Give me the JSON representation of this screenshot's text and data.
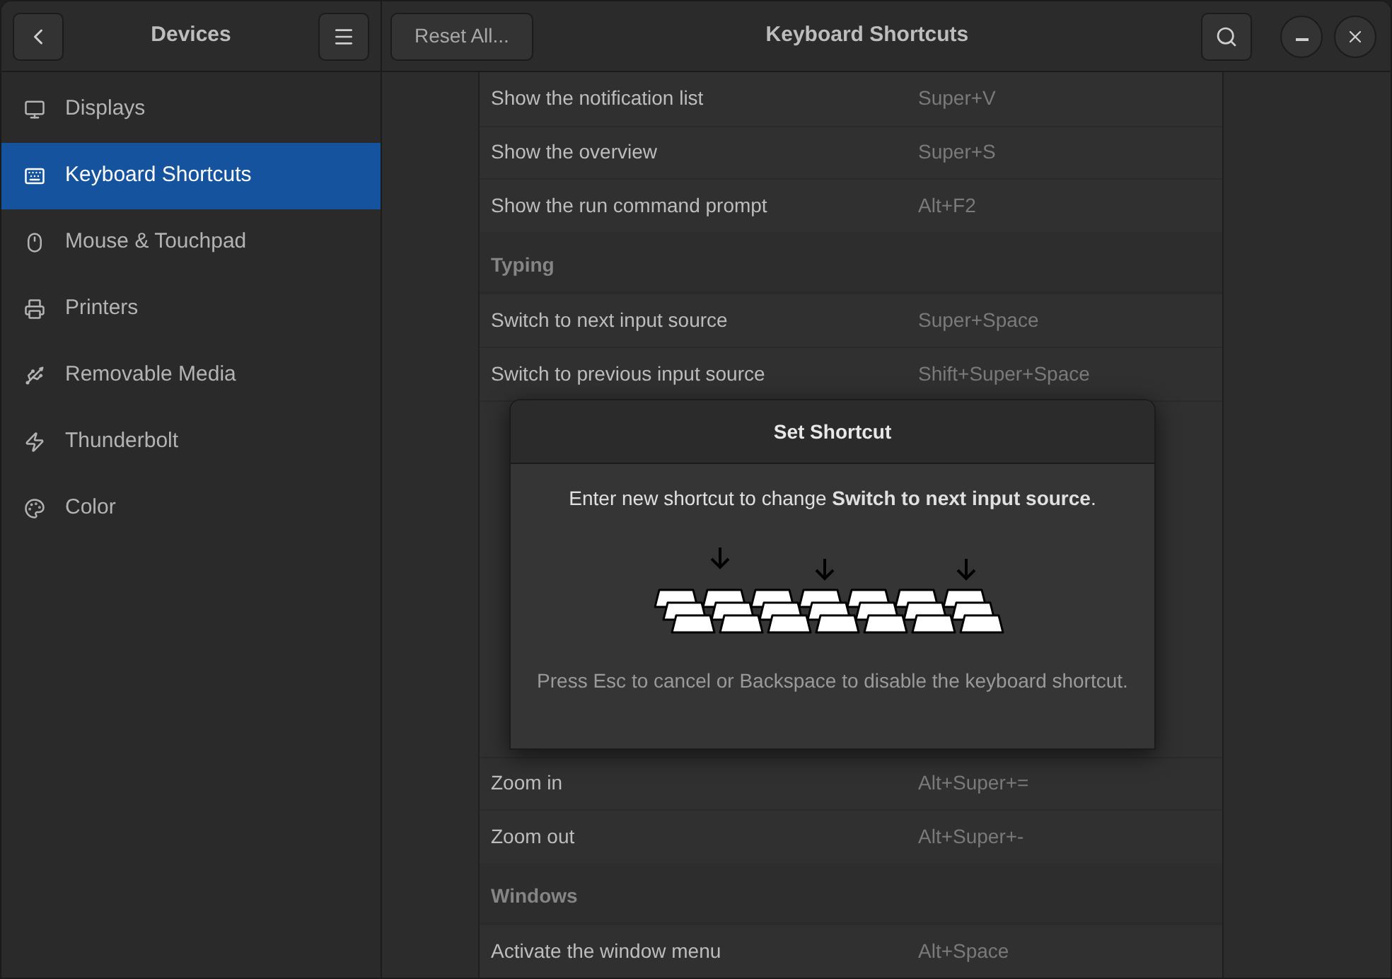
{
  "sidebar_header": {
    "title": "Devices"
  },
  "sidebar": {
    "items": [
      {
        "label": "Displays",
        "selected": false
      },
      {
        "label": "Keyboard Shortcuts",
        "selected": true
      },
      {
        "label": "Mouse & Touchpad",
        "selected": false
      },
      {
        "label": "Printers",
        "selected": false
      },
      {
        "label": "Removable Media",
        "selected": false
      },
      {
        "label": "Thunderbolt",
        "selected": false
      },
      {
        "label": "Color",
        "selected": false
      }
    ]
  },
  "header": {
    "reset_button": "Reset All...",
    "title": "Keyboard Shortcuts"
  },
  "shortcuts_above": [
    {
      "kind": "row",
      "name": "Show the notification list",
      "shortcut": "Super+V"
    },
    {
      "kind": "row",
      "name": "Show the overview",
      "shortcut": "Super+S"
    },
    {
      "kind": "row",
      "name": "Show the run command prompt",
      "shortcut": "Alt+F2"
    },
    {
      "kind": "section",
      "name": "Typing"
    },
    {
      "kind": "row",
      "name": "Switch to next input source",
      "shortcut": "Super+Space"
    },
    {
      "kind": "row",
      "name": "Switch to previous input source",
      "shortcut": "Shift+Super+Space"
    }
  ],
  "shortcuts_below": [
    {
      "kind": "row",
      "name": "Zoom in",
      "shortcut": "Alt+Super+="
    },
    {
      "kind": "row",
      "name": "Zoom out",
      "shortcut": "Alt+Super+-"
    },
    {
      "kind": "section",
      "name": "Windows"
    },
    {
      "kind": "row",
      "name": "Activate the window menu",
      "shortcut": "Alt+Space"
    }
  ],
  "dialog": {
    "title": "Set Shortcut",
    "message": "Enter new shortcut to change **Switch to next input source**.",
    "hint": "Press Esc to cancel or Backspace to disable the keyboard shortcut."
  }
}
